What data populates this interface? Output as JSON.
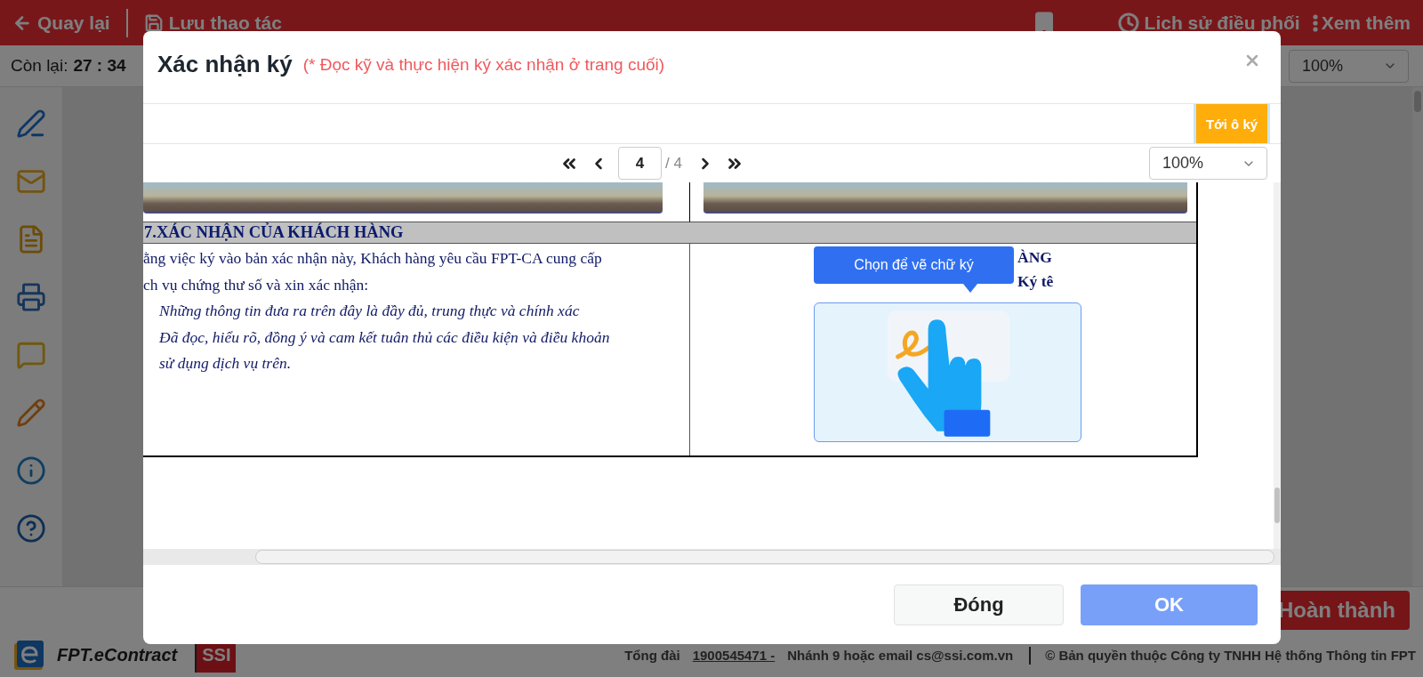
{
  "topbar": {
    "back": "Quay lại",
    "save": "Lưu thao tác",
    "history": "Lịch sử điều phối",
    "more": "Xem thêm"
  },
  "timer": {
    "label": "Còn lại:",
    "value": "27 : 34"
  },
  "zoom": "100%",
  "finish_button": "Hoàn thành",
  "footer": {
    "brand": "FPT.eContract",
    "partner": "SSI",
    "hotline_label": "Tổng đài ",
    "hotline": "1900545471 - ",
    "contact": "Nhánh 9 hoặc email cs@ssi.com.vn",
    "copyright": "© Bản quyền thuộc Công ty TNHH Hệ thống Thông tin FPT"
  },
  "dialog": {
    "title": "Xác nhận ký",
    "note": "(* Đọc kỹ và thực hiện ký xác nhận ở trang cuối)",
    "goto_sign": "Tới ô ký",
    "pager": {
      "page": "4",
      "total": "/ 4"
    },
    "zoom": "100%",
    "document": {
      "section_heading": "7.XÁC NHẬN CỦA KHÁCH HÀNG",
      "lines": [
        {
          "kind": "plain",
          "text": "ằng việc ký vào bản xác nhận này, Khách hàng yêu cầu FPT-CA cung cấp"
        },
        {
          "kind": "plain",
          "text": "ch vụ chứng thư số và xin xác nhận:"
        },
        {
          "kind": "italic",
          "text": "Những thông tin đưa ra trên đây là đầy đủ, trung thực và chính xác"
        },
        {
          "kind": "italic",
          "text": "Đã đọc, hiểu rõ, đồng ý và cam kết tuân thủ các điều kiện và điều khoản"
        },
        {
          "kind": "italic",
          "text": "sử dụng dịch vụ trên."
        }
      ],
      "signer_heading": "ÀNG",
      "signer_label": "Ký tê",
      "sign_tooltip": "Chọn để vẽ chữ ký"
    },
    "buttons": {
      "close": "Đóng",
      "ok": "OK"
    }
  }
}
